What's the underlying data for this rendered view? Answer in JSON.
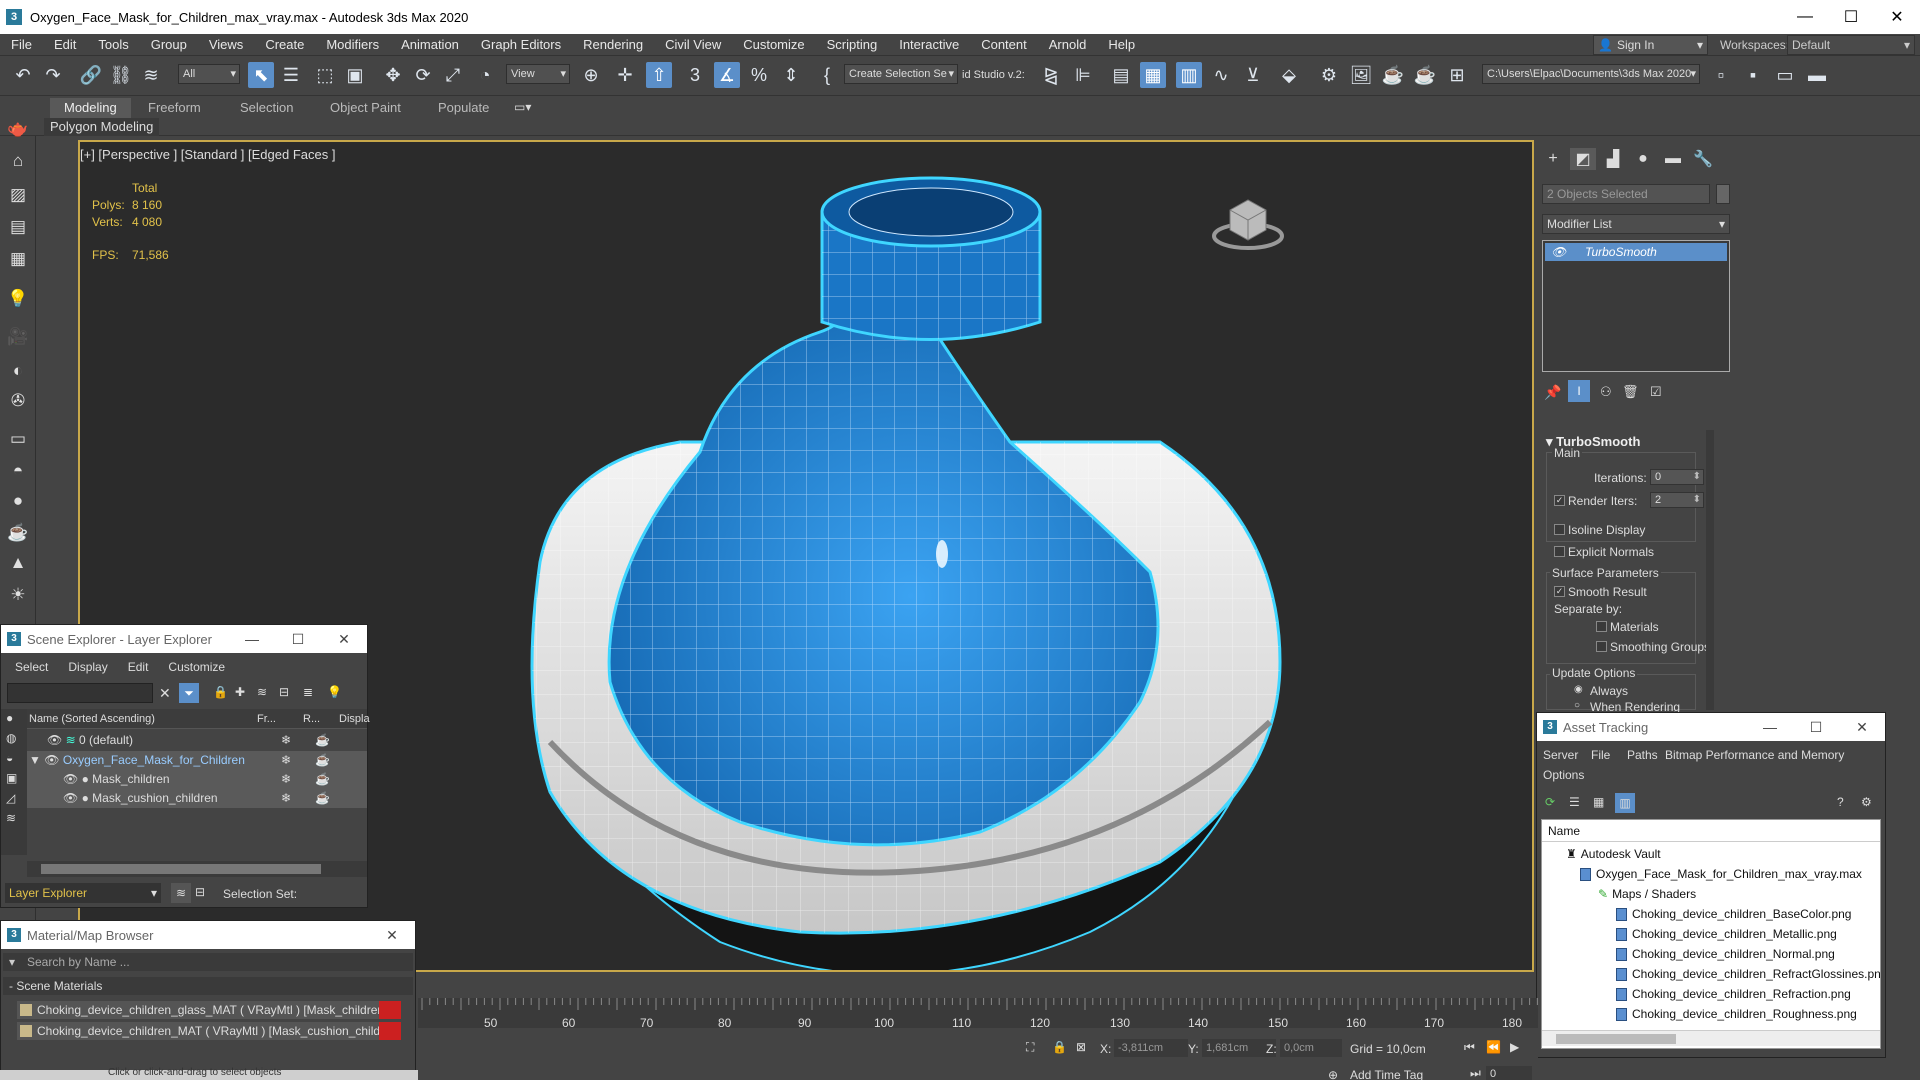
{
  "window": {
    "title": "Oxygen_Face_Mask_for_Children_max_vray.max - Autodesk 3ds Max 2020"
  },
  "menu": [
    "File",
    "Edit",
    "Tools",
    "Group",
    "Views",
    "Create",
    "Modifiers",
    "Animation",
    "Graph Editors",
    "Rendering",
    "Civil View",
    "Customize",
    "Scripting",
    "Interactive",
    "Content",
    "Arnold",
    "Help"
  ],
  "account": {
    "signin": "Sign In",
    "workspaces_label": "Workspaces:",
    "workspace": "Default"
  },
  "toolbar": {
    "filter": "All",
    "refcoord": "View",
    "named_sel": "Create Selection Se",
    "studio": "id Studio v.2:",
    "project_path": "C:\\Users\\Elpac\\Documents\\3ds Max 2020"
  },
  "ribbon": {
    "tabs": [
      "Modeling",
      "Freeform",
      "Selection",
      "Object Paint",
      "Populate"
    ],
    "sub": "Polygon Modeling"
  },
  "viewport": {
    "label": "[+] [Perspective ] [Standard ] [Edged Faces ]",
    "stats": {
      "total": "Total",
      "polys_label": "Polys:",
      "polys": "8 160",
      "verts_label": "Verts:",
      "verts": "4 080",
      "fps_label": "FPS:",
      "fps": "71,586"
    }
  },
  "command_panel": {
    "selection": "2 Objects Selected",
    "modifier_list": "Modifier List",
    "stack_item": "TurboSmooth",
    "rollout": "TurboSmooth",
    "main": "Main",
    "iterations_label": "Iterations:",
    "iterations": "0",
    "render_iters_label": "Render Iters:",
    "render_iters": "2",
    "isoline": "Isoline Display",
    "explicit_normals": "Explicit Normals",
    "surface_params": "Surface Parameters",
    "smooth_result": "Smooth Result",
    "separate_by": "Separate by:",
    "materials": "Materials",
    "smoothing_groups": "Smoothing Groups",
    "update_options": "Update Options",
    "always": "Always",
    "when_rendering": "When Rendering"
  },
  "scene_explorer": {
    "title": "Scene Explorer - Layer Explorer",
    "menu": [
      "Select",
      "Display",
      "Edit",
      "Customize"
    ],
    "columns": [
      "Name (Sorted Ascending)",
      "Fr...",
      "R...",
      "Displa"
    ],
    "rows": [
      "0 (default)",
      "Oxygen_Face_Mask_for_Children",
      "Mask_children",
      "Mask_cushion_children"
    ],
    "footer": "Layer Explorer",
    "selection_set": "Selection Set:"
  },
  "material_browser": {
    "title": "Material/Map Browser",
    "search": "Search by Name ...",
    "section": "- Scene Materials",
    "items": [
      "Choking_device_children_glass_MAT ( VRayMtl ) [Mask_children]",
      "Choking_device_children_MAT ( VRayMtl ) [Mask_cushion_children]"
    ]
  },
  "asset_tracking": {
    "title": "Asset Tracking",
    "menu": [
      "Server",
      "File",
      "Paths",
      "Bitmap Performance and Memory",
      "Options"
    ],
    "column": "Name",
    "vault": "Autodesk Vault",
    "file": "Oxygen_Face_Mask_for_Children_max_vray.max",
    "maps": "Maps / Shaders",
    "maps_list": [
      "Choking_device_children_BaseColor.png",
      "Choking_device_children_Metallic.png",
      "Choking_device_children_Normal.png",
      "Choking_device_children_RefractGlossines.png",
      "Choking_device_children_Refraction.png",
      "Choking_device_children_Roughness.png"
    ]
  },
  "timeline": {
    "ticks": [
      "50",
      "60",
      "70",
      "80",
      "90",
      "100",
      "110",
      "120",
      "130",
      "140",
      "150",
      "160",
      "170",
      "180"
    ]
  },
  "status": {
    "x_label": "X:",
    "x": "-3,811cm",
    "y_label": "Y:",
    "y": "1,681cm",
    "z_label": "Z:",
    "z": "0,0cm",
    "grid": "Grid = 10,0cm",
    "add_time_tag": "Add Time Tag",
    "frame": "0",
    "prompt": "Click or click-and-drag to select objects"
  },
  "colors": {
    "accent": "#5b8fc9",
    "mask_blue": "#1d83d8",
    "selection_outline": "#3fd6ff",
    "viewport_border": "#c8a84a",
    "stats_text": "#e2c24a",
    "material_red": "#cc2020"
  }
}
